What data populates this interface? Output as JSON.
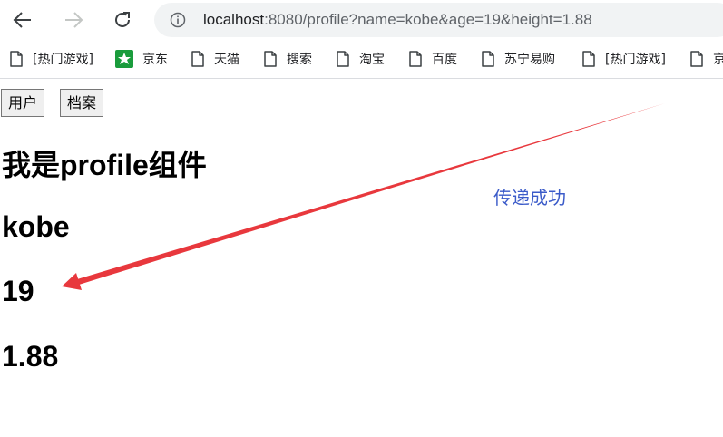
{
  "browser": {
    "url_host": "localhost",
    "url_rest": ":8080/profile?name=kobe&age=19&height=1.88"
  },
  "bookmarks": [
    {
      "label": "[热门游戏]",
      "icon": "page-icon"
    },
    {
      "label": "京东",
      "icon": "jd-icon"
    },
    {
      "label": "天猫",
      "icon": "page-icon"
    },
    {
      "label": "搜索",
      "icon": "page-icon"
    },
    {
      "label": "淘宝",
      "icon": "page-icon"
    },
    {
      "label": "百度",
      "icon": "page-icon"
    },
    {
      "label": "苏宁易购",
      "icon": "page-icon"
    },
    {
      "label": "[热门游戏]",
      "icon": "page-icon"
    },
    {
      "label": "京",
      "icon": "page-icon"
    }
  ],
  "page": {
    "buttons": {
      "user": "用户",
      "profile": "档案"
    },
    "title": "我是profile组件",
    "name": "kobe",
    "age": "19",
    "height": "1.88"
  },
  "annotation": {
    "text": "传递成功",
    "color": "#3b5bc9",
    "arrow_color": "#e8383d"
  }
}
